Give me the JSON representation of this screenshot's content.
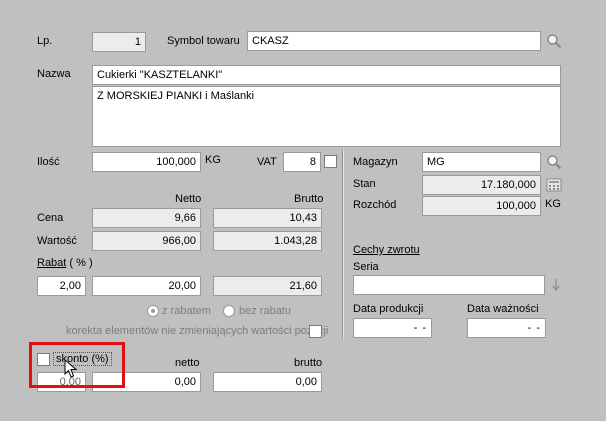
{
  "header": {
    "lp_label": "Lp.",
    "lp_value": "1",
    "symbol_label": "Symbol towaru",
    "symbol_value": "CKASZ"
  },
  "name": {
    "label": "Nazwa",
    "line1": "Cukierki \"KASZTELANKI\"",
    "line2": "Z MORSKIEJ PIANKI i Maślanki"
  },
  "quantity": {
    "label": "Ilość",
    "value": "100,000",
    "unit": "KG",
    "vat_label": "VAT",
    "vat_value": "8"
  },
  "prices": {
    "netto_header": "Netto",
    "brutto_header": "Brutto",
    "cena_label": "Cena",
    "cena_netto": "9,66",
    "cena_brutto": "10,43",
    "wartosc_label": "Wartość",
    "wartosc_netto": "966,00",
    "wartosc_brutto": "1.043,28",
    "rabat_label": "Rabat",
    "rabat_pct": "( % )",
    "rabat_percent_value": "2,00",
    "rabat_netto": "20,00",
    "rabat_brutto": "21,60",
    "radio_with_discount": "z rabatem",
    "radio_without_discount": "bez rabatu",
    "korekta_label": "korekta elementów nie zmieniających wartości pozycji"
  },
  "skonto": {
    "label": "skonto (%)",
    "netto_header": "netto",
    "brutto_header": "brutto",
    "percent_value": "0,00",
    "netto_value": "0,00",
    "brutto_value": "0,00"
  },
  "warehouse": {
    "magazyn_label": "Magazyn",
    "magazyn_value": "MG",
    "stan_label": "Stan",
    "stan_value": "17.180,000",
    "rozchod_label": "Rozchód",
    "rozchod_value": "100,000",
    "rozchod_unit": "KG"
  },
  "return": {
    "cechy_label": "Cechy zwrotu",
    "seria_label": "Seria",
    "seria_value": "",
    "data_produkcji_label": "Data produkcji",
    "data_produkcji_value": "-  -",
    "data_waznosci_label": "Data ważności",
    "data_waznosci_value": "-  -"
  },
  "colors": {
    "background": "#c0c0c0",
    "highlight_box": "#e01010"
  },
  "icons": {
    "symbol_lookup": "magnifier-icon",
    "magazyn_lookup": "magnifier-icon",
    "stan_button": "calculator-icon",
    "seria_arrow": "arrow-down-icon",
    "cursor": "mouse-pointer-icon"
  }
}
